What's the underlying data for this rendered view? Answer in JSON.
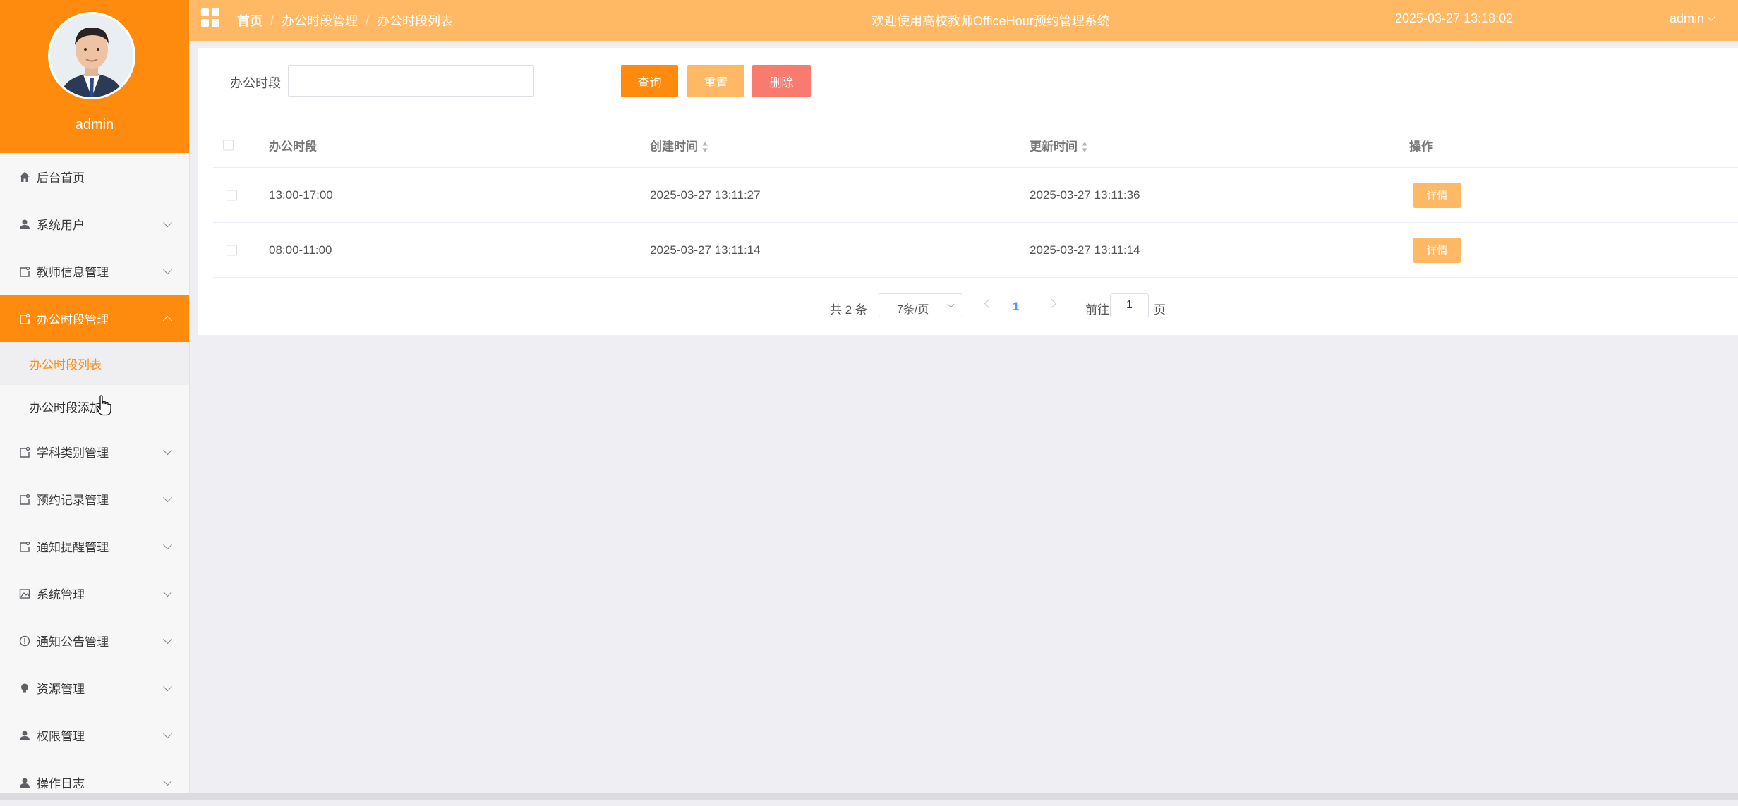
{
  "profile": {
    "name": "admin"
  },
  "header": {
    "breadcrumb": [
      "首页",
      "办公时段管理",
      "办公时段列表"
    ],
    "separator": "/",
    "welcome": "欢迎使用高校教师OfficeHour预约管理系统",
    "datetime": "2025-03-27 13:18:02",
    "user": "admin"
  },
  "sidebar": {
    "items": [
      {
        "label": "后台首页",
        "icon": "home-icon",
        "has_children": false
      },
      {
        "label": "系统用户",
        "icon": "user-icon",
        "has_children": true
      },
      {
        "label": "教师信息管理",
        "icon": "doc-icon",
        "has_children": true
      },
      {
        "label": "办公时段管理",
        "icon": "doc-icon",
        "has_children": true,
        "active": true,
        "children": [
          {
            "label": "办公时段列表",
            "current": true
          },
          {
            "label": "办公时段添加"
          }
        ]
      },
      {
        "label": "学科类别管理",
        "icon": "doc-icon",
        "has_children": true
      },
      {
        "label": "预约记录管理",
        "icon": "doc-icon",
        "has_children": true
      },
      {
        "label": "通知提醒管理",
        "icon": "doc-icon",
        "has_children": true
      },
      {
        "label": "系统管理",
        "icon": "picture-icon",
        "has_children": true
      },
      {
        "label": "通知公告管理",
        "icon": "info-icon",
        "has_children": true
      },
      {
        "label": "资源管理",
        "icon": "bulb-icon",
        "has_children": true
      },
      {
        "label": "权限管理",
        "icon": "user-icon",
        "has_children": true
      },
      {
        "label": "操作日志",
        "icon": "user-icon",
        "has_children": true
      }
    ]
  },
  "search": {
    "label": "办公时段",
    "value": "",
    "placeholder": ""
  },
  "buttons": {
    "query": "查询",
    "reset": "重置",
    "delete": "删除"
  },
  "table": {
    "columns": [
      "办公时段",
      "创建时间",
      "更新时间",
      "操作"
    ],
    "rows": [
      {
        "period": "13:00-17:00",
        "created": "2025-03-27 13:11:27",
        "updated": "2025-03-27 13:11:36",
        "action": "详情"
      },
      {
        "period": "08:00-11:00",
        "created": "2025-03-27 13:11:14",
        "updated": "2025-03-27 13:11:14",
        "action": "详情"
      }
    ]
  },
  "pagination": {
    "total_text": "共 2 条",
    "page_size": "7条/页",
    "current_page": "1",
    "goto_label": "前往",
    "goto_value": "1",
    "goto_unit": "页"
  },
  "colors": {
    "primary": "#ff8b0e",
    "header": "#ffb964",
    "danger": "#f97b70",
    "link": "#409eff"
  }
}
